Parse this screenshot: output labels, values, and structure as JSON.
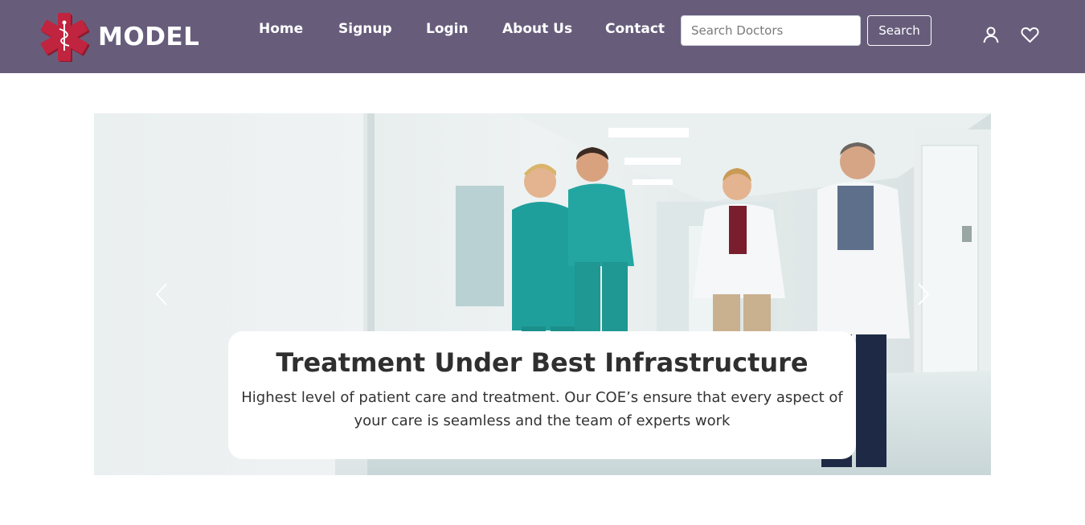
{
  "header": {
    "brand_name": "MODEL",
    "nav": [
      {
        "label": "Home"
      },
      {
        "label": "Signup"
      },
      {
        "label": "Login"
      },
      {
        "label": "About Us"
      },
      {
        "label": "Contact"
      }
    ],
    "search": {
      "placeholder": "Search Doctors",
      "value": "",
      "button_label": "Search"
    },
    "icons": [
      "user-icon",
      "heart-icon"
    ],
    "background_color": "#675d7b",
    "logo_color": "#b5213a"
  },
  "carousel": {
    "title": "Treatment Under Best Infrastructure",
    "text": "Highest level of patient care and treatment. Our COE’s ensure that every aspect of your care is seamless and the team of experts work",
    "image_subject": "doctors and nurses talking in hospital corridor",
    "controls": [
      "chevron-left-icon",
      "chevron-right-icon"
    ]
  }
}
